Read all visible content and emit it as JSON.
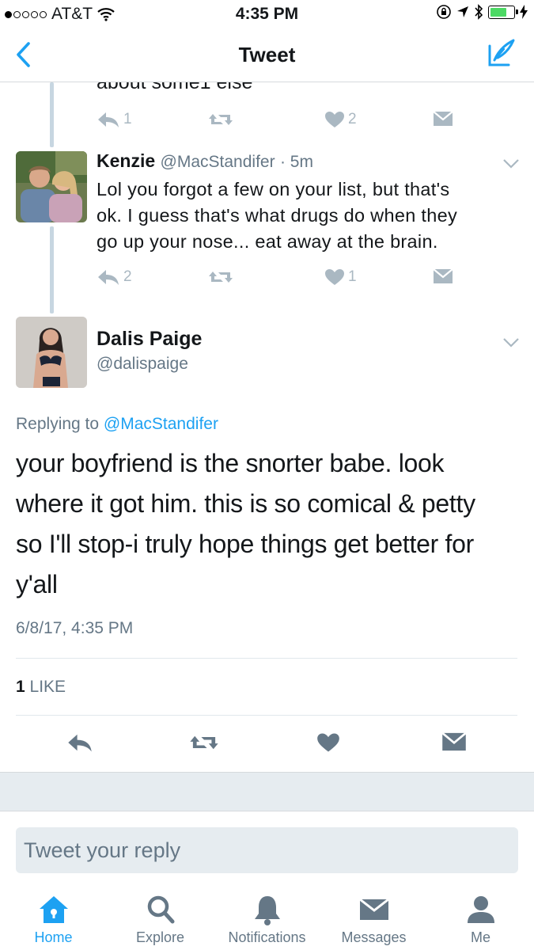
{
  "status_bar": {
    "carrier": "AT&T",
    "time": "4:35 PM"
  },
  "nav": {
    "title": "Tweet",
    "icons": [
      "chevron-left-icon",
      "compose-tweet-icon"
    ]
  },
  "thread": {
    "cut_text": "about some1 else",
    "prev_tweet_actions": {
      "reply_count": "1",
      "like_count": "2"
    },
    "reply_tweet": {
      "name": "Kenzie",
      "handle": "@MacStandifer",
      "age": "· 5m",
      "lines": [
        "Lol you forgot a few on your list, but that's",
        "ok. I guess that's what drugs do when they",
        "go up your nose... eat away at the brain."
      ],
      "reply_count": "2",
      "like_count": "1"
    }
  },
  "main_tweet": {
    "name": "Dalis Paige",
    "handle": "@dalispaige",
    "replying_prefix": "Replying to",
    "replying_handle": "@MacStandifer",
    "lines": [
      "your boyfriend is the snorter babe. look",
      "where it got him. this is so comical & petty",
      "so I'll stop-i truly hope things get better for",
      "y'all"
    ],
    "timestamp": "6/8/17, 4:35 PM",
    "likes_count": "1",
    "likes_label": "LIKE"
  },
  "reply_box": {
    "placeholder": "Tweet your reply"
  },
  "tabs": [
    {
      "label": "Home",
      "icon": "home-icon",
      "active": true
    },
    {
      "label": "Explore",
      "icon": "search-icon",
      "active": false
    },
    {
      "label": "Notifications",
      "icon": "bell-icon",
      "active": false
    },
    {
      "label": "Messages",
      "icon": "envelope-icon",
      "active": false
    },
    {
      "label": "Me",
      "icon": "person-icon",
      "active": false
    }
  ],
  "colors": {
    "accent": "#1da1f2",
    "icon_gray": "#aab8c2",
    "action_gray": "#657786",
    "thread_line": "#c7d6e1",
    "battery": "#4cd964"
  }
}
